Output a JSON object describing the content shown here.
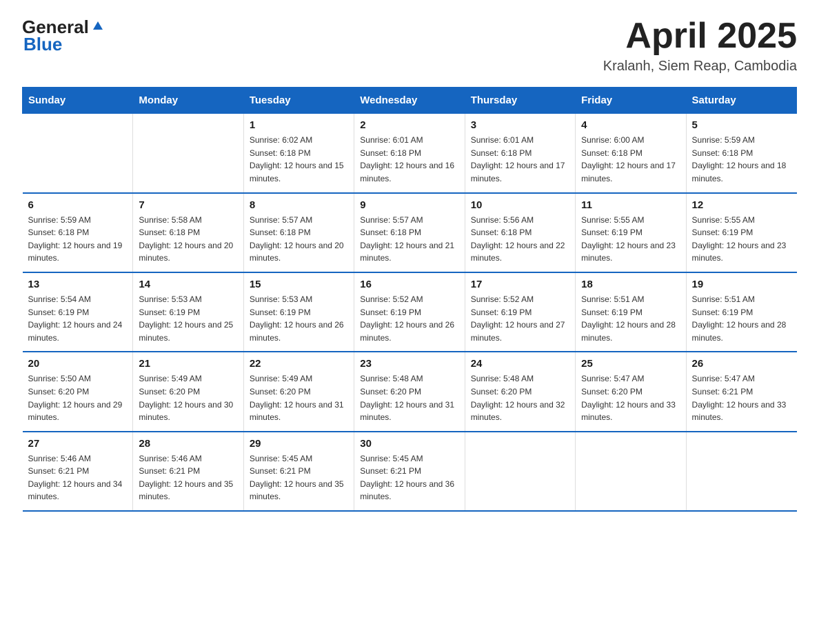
{
  "header": {
    "logo_general": "General",
    "logo_blue": "Blue",
    "month_title": "April 2025",
    "location": "Kralanh, Siem Reap, Cambodia"
  },
  "weekdays": [
    "Sunday",
    "Monday",
    "Tuesday",
    "Wednesday",
    "Thursday",
    "Friday",
    "Saturday"
  ],
  "weeks": [
    [
      {
        "day": "",
        "sunrise": "",
        "sunset": "",
        "daylight": ""
      },
      {
        "day": "",
        "sunrise": "",
        "sunset": "",
        "daylight": ""
      },
      {
        "day": "1",
        "sunrise": "Sunrise: 6:02 AM",
        "sunset": "Sunset: 6:18 PM",
        "daylight": "Daylight: 12 hours and 15 minutes."
      },
      {
        "day": "2",
        "sunrise": "Sunrise: 6:01 AM",
        "sunset": "Sunset: 6:18 PM",
        "daylight": "Daylight: 12 hours and 16 minutes."
      },
      {
        "day": "3",
        "sunrise": "Sunrise: 6:01 AM",
        "sunset": "Sunset: 6:18 PM",
        "daylight": "Daylight: 12 hours and 17 minutes."
      },
      {
        "day": "4",
        "sunrise": "Sunrise: 6:00 AM",
        "sunset": "Sunset: 6:18 PM",
        "daylight": "Daylight: 12 hours and 17 minutes."
      },
      {
        "day": "5",
        "sunrise": "Sunrise: 5:59 AM",
        "sunset": "Sunset: 6:18 PM",
        "daylight": "Daylight: 12 hours and 18 minutes."
      }
    ],
    [
      {
        "day": "6",
        "sunrise": "Sunrise: 5:59 AM",
        "sunset": "Sunset: 6:18 PM",
        "daylight": "Daylight: 12 hours and 19 minutes."
      },
      {
        "day": "7",
        "sunrise": "Sunrise: 5:58 AM",
        "sunset": "Sunset: 6:18 PM",
        "daylight": "Daylight: 12 hours and 20 minutes."
      },
      {
        "day": "8",
        "sunrise": "Sunrise: 5:57 AM",
        "sunset": "Sunset: 6:18 PM",
        "daylight": "Daylight: 12 hours and 20 minutes."
      },
      {
        "day": "9",
        "sunrise": "Sunrise: 5:57 AM",
        "sunset": "Sunset: 6:18 PM",
        "daylight": "Daylight: 12 hours and 21 minutes."
      },
      {
        "day": "10",
        "sunrise": "Sunrise: 5:56 AM",
        "sunset": "Sunset: 6:18 PM",
        "daylight": "Daylight: 12 hours and 22 minutes."
      },
      {
        "day": "11",
        "sunrise": "Sunrise: 5:55 AM",
        "sunset": "Sunset: 6:19 PM",
        "daylight": "Daylight: 12 hours and 23 minutes."
      },
      {
        "day": "12",
        "sunrise": "Sunrise: 5:55 AM",
        "sunset": "Sunset: 6:19 PM",
        "daylight": "Daylight: 12 hours and 23 minutes."
      }
    ],
    [
      {
        "day": "13",
        "sunrise": "Sunrise: 5:54 AM",
        "sunset": "Sunset: 6:19 PM",
        "daylight": "Daylight: 12 hours and 24 minutes."
      },
      {
        "day": "14",
        "sunrise": "Sunrise: 5:53 AM",
        "sunset": "Sunset: 6:19 PM",
        "daylight": "Daylight: 12 hours and 25 minutes."
      },
      {
        "day": "15",
        "sunrise": "Sunrise: 5:53 AM",
        "sunset": "Sunset: 6:19 PM",
        "daylight": "Daylight: 12 hours and 26 minutes."
      },
      {
        "day": "16",
        "sunrise": "Sunrise: 5:52 AM",
        "sunset": "Sunset: 6:19 PM",
        "daylight": "Daylight: 12 hours and 26 minutes."
      },
      {
        "day": "17",
        "sunrise": "Sunrise: 5:52 AM",
        "sunset": "Sunset: 6:19 PM",
        "daylight": "Daylight: 12 hours and 27 minutes."
      },
      {
        "day": "18",
        "sunrise": "Sunrise: 5:51 AM",
        "sunset": "Sunset: 6:19 PM",
        "daylight": "Daylight: 12 hours and 28 minutes."
      },
      {
        "day": "19",
        "sunrise": "Sunrise: 5:51 AM",
        "sunset": "Sunset: 6:19 PM",
        "daylight": "Daylight: 12 hours and 28 minutes."
      }
    ],
    [
      {
        "day": "20",
        "sunrise": "Sunrise: 5:50 AM",
        "sunset": "Sunset: 6:20 PM",
        "daylight": "Daylight: 12 hours and 29 minutes."
      },
      {
        "day": "21",
        "sunrise": "Sunrise: 5:49 AM",
        "sunset": "Sunset: 6:20 PM",
        "daylight": "Daylight: 12 hours and 30 minutes."
      },
      {
        "day": "22",
        "sunrise": "Sunrise: 5:49 AM",
        "sunset": "Sunset: 6:20 PM",
        "daylight": "Daylight: 12 hours and 31 minutes."
      },
      {
        "day": "23",
        "sunrise": "Sunrise: 5:48 AM",
        "sunset": "Sunset: 6:20 PM",
        "daylight": "Daylight: 12 hours and 31 minutes."
      },
      {
        "day": "24",
        "sunrise": "Sunrise: 5:48 AM",
        "sunset": "Sunset: 6:20 PM",
        "daylight": "Daylight: 12 hours and 32 minutes."
      },
      {
        "day": "25",
        "sunrise": "Sunrise: 5:47 AM",
        "sunset": "Sunset: 6:20 PM",
        "daylight": "Daylight: 12 hours and 33 minutes."
      },
      {
        "day": "26",
        "sunrise": "Sunrise: 5:47 AM",
        "sunset": "Sunset: 6:21 PM",
        "daylight": "Daylight: 12 hours and 33 minutes."
      }
    ],
    [
      {
        "day": "27",
        "sunrise": "Sunrise: 5:46 AM",
        "sunset": "Sunset: 6:21 PM",
        "daylight": "Daylight: 12 hours and 34 minutes."
      },
      {
        "day": "28",
        "sunrise": "Sunrise: 5:46 AM",
        "sunset": "Sunset: 6:21 PM",
        "daylight": "Daylight: 12 hours and 35 minutes."
      },
      {
        "day": "29",
        "sunrise": "Sunrise: 5:45 AM",
        "sunset": "Sunset: 6:21 PM",
        "daylight": "Daylight: 12 hours and 35 minutes."
      },
      {
        "day": "30",
        "sunrise": "Sunrise: 5:45 AM",
        "sunset": "Sunset: 6:21 PM",
        "daylight": "Daylight: 12 hours and 36 minutes."
      },
      {
        "day": "",
        "sunrise": "",
        "sunset": "",
        "daylight": ""
      },
      {
        "day": "",
        "sunrise": "",
        "sunset": "",
        "daylight": ""
      },
      {
        "day": "",
        "sunrise": "",
        "sunset": "",
        "daylight": ""
      }
    ]
  ]
}
